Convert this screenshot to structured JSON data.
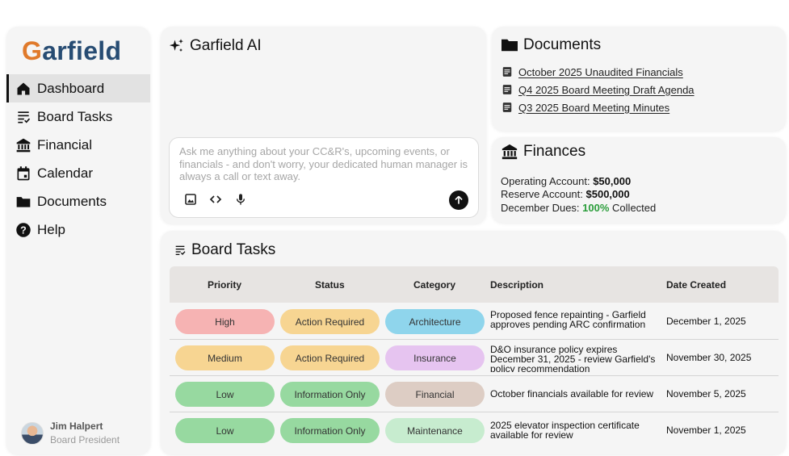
{
  "brand": {
    "logo_first": "G",
    "logo_rest": "arfield"
  },
  "nav": [
    {
      "label": "Dashboard",
      "icon": "home-icon",
      "active": true
    },
    {
      "label": "Board Tasks",
      "icon": "tasks-icon"
    },
    {
      "label": "Financial",
      "icon": "bank-icon"
    },
    {
      "label": "Calendar",
      "icon": "calendar-icon"
    },
    {
      "label": "Documents",
      "icon": "folder-icon"
    },
    {
      "label": "Help",
      "icon": "help-icon"
    }
  ],
  "user": {
    "name": "Jim Halpert",
    "role": "Board President"
  },
  "ai": {
    "title": "Garfield AI",
    "placeholder": "Ask me anything about your CC&R's, upcoming events, or financials - and don't worry, your dedicated human manager is always a call or text away."
  },
  "documents": {
    "title": "Documents",
    "items": [
      "October 2025 Unaudited Financials",
      "Q4 2025 Board Meeting Draft Agenda",
      "Q3 2025 Board Meeting Minutes"
    ]
  },
  "finances": {
    "title": "Finances",
    "operating_label": "Operating Account:",
    "operating_value": "$50,000",
    "reserve_label": "Reserve Account:",
    "reserve_value": "$500,000",
    "dues_label": "December Dues:",
    "dues_value": "100%",
    "dues_suffix": "Collected"
  },
  "tasks": {
    "title": "Board Tasks",
    "headers": [
      "Priority",
      "Status",
      "Category",
      "Description",
      "Date Created"
    ],
    "rows": [
      {
        "priority": "High",
        "status": "Action Required",
        "category": "Architecture",
        "description": "Proposed fence repainting - Garfield approves pending ARC confirmation",
        "date": "December 1, 2025"
      },
      {
        "priority": "Medium",
        "status": "Action Required",
        "category": "Insurance",
        "description": "D&O insurance policy expires December 31, 2025 - review Garfield's policy recommendation",
        "date": "November 30, 2025"
      },
      {
        "priority": "Low",
        "status": "Information Only",
        "category": "Financial",
        "description": "October financials available for review",
        "date": "November 5, 2025"
      },
      {
        "priority": "Low",
        "status": "Information Only",
        "category": "Maintenance",
        "description": "2025 elevator inspection certificate available for review",
        "date": "November 1, 2025"
      }
    ]
  },
  "colors": {
    "priority_high": "#f6b3b3",
    "priority_medium": "#f7d592",
    "priority_low": "#97d9a0",
    "status_action": "#f7d592",
    "status_info": "#97d9a0",
    "cat_architecture": "#8fd5ec",
    "cat_insurance": "#e6c4f0",
    "cat_financial": "#ddcdc4",
    "cat_maintenance": "#c7eccf",
    "brand_blue": "#274c73",
    "brand_orange": "#e07a2b",
    "dues_green": "#2a9d3a"
  }
}
